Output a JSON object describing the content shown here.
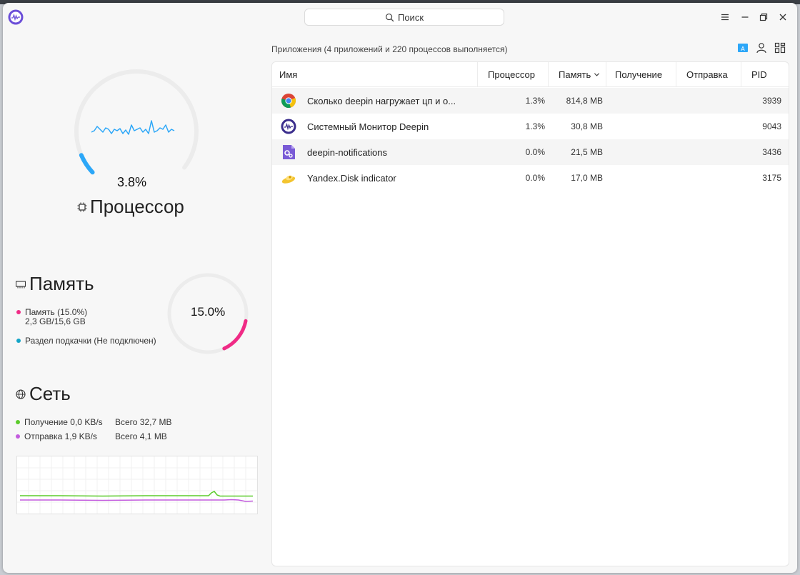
{
  "search": {
    "label": "Поиск"
  },
  "cpu": {
    "title": "Процессор",
    "value": "3.8%",
    "usage": 0.038,
    "color": "#2ca7f8"
  },
  "memory": {
    "title": "Память",
    "value": "15.0%",
    "usage": 0.15,
    "color": "#f02b86",
    "ram_label": "Память (15.0%)",
    "ram_detail": "2,3 GB/15,6 GB",
    "swap_label": "Раздел подкачки (Не подключен)",
    "swap_color": "#14a5c7"
  },
  "network": {
    "title": "Сеть",
    "recv_label": "Получение 0,0 KB/s",
    "recv_total": "Всего 32,7 MB",
    "recv_color": "#5ccb2c",
    "send_label": "Отправка 1,9 KB/s",
    "send_total": "Всего 4,1 MB",
    "send_color": "#c35cde"
  },
  "processes": {
    "title": "Приложения (4 приложений и 220 процессов выполняется)",
    "columns": {
      "name": "Имя",
      "cpu": "Процессор",
      "memory": "Память",
      "recv": "Получение",
      "send": "Отправка",
      "pid": "PID"
    },
    "rows": [
      {
        "name": "Сколько deepin нагружает цп и о...",
        "cpu": "1.3%",
        "memory": "814,8 MB",
        "recv": "",
        "send": "",
        "pid": "3939",
        "icon": "chrome-icon"
      },
      {
        "name": "Системный Монитор Deepin",
        "cpu": "1.3%",
        "memory": "30,8 MB",
        "recv": "",
        "send": "",
        "pid": "9043",
        "icon": "system-monitor-icon"
      },
      {
        "name": "deepin-notifications",
        "cpu": "0.0%",
        "memory": "21,5 MB",
        "recv": "",
        "send": "",
        "pid": "3436",
        "icon": "notifications-icon"
      },
      {
        "name": "Yandex.Disk indicator",
        "cpu": "0.0%",
        "memory": "17,0 MB",
        "recv": "",
        "send": "",
        "pid": "3175",
        "icon": "yandex-disk-icon"
      }
    ]
  }
}
